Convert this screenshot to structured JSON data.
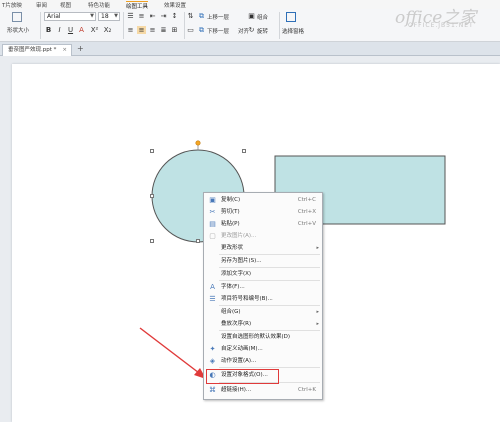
{
  "menu_tabs": [
    "T片放映",
    "审阅",
    "视图",
    "特色功能",
    "绘图工具",
    "效果设置"
  ],
  "ribbon": {
    "shape_size_label": "形状大小",
    "font_name": "Arial",
    "font_size": "18",
    "bring_forward": "上移一层",
    "send_backward": "下移一层",
    "align": "对齐",
    "group": "组合",
    "rotate": "旋转",
    "selection_pane": "选择窗格"
  },
  "document_tab": {
    "name": "垂奈图严效现.ppt *",
    "close": "×",
    "new_tab": "+"
  },
  "watermark": {
    "text": "office之家",
    "sub": "OFFICE.JB51.NET"
  },
  "shapes": {
    "fill": "#bfe2e4",
    "stroke": "#555555"
  },
  "context_menu": {
    "items": [
      {
        "label": "复制(C)",
        "shortcut": "Ctrl+C",
        "icon": "copy-icon",
        "glyph": "▣"
      },
      {
        "label": "剪切(T)",
        "shortcut": "Ctrl+X",
        "icon": "scissors-icon",
        "glyph": "✂"
      },
      {
        "label": "粘贴(P)",
        "shortcut": "Ctrl+V",
        "icon": "paste-icon",
        "glyph": "▤"
      },
      {
        "label": "更改图片(A)...",
        "disabled": true,
        "icon": "image-icon",
        "glyph": "▢"
      },
      {
        "label": "更改形状",
        "submenu": true
      },
      {
        "label": "另存为图片(S)..."
      },
      {
        "label": "添加文字(X)"
      },
      {
        "label": "字体(F)...",
        "icon": "font-icon",
        "glyph": "A"
      },
      {
        "label": "项目符号和编号(B)...",
        "icon": "bullet-list-icon",
        "glyph": "☰"
      },
      {
        "label": "组合(G)",
        "submenu": true
      },
      {
        "label": "叠放次序(R)",
        "submenu": true
      },
      {
        "label": "设置自选图形的默认效果(D)"
      },
      {
        "label": "自定义动画(M)...",
        "icon": "animation-icon",
        "glyph": "✦"
      },
      {
        "label": "动作设置(A)...",
        "icon": "action-icon",
        "glyph": "◈"
      },
      {
        "label": "设置对象格式(O)...",
        "icon": "format-object-icon",
        "glyph": "◐"
      },
      {
        "label": "超链接(H)...",
        "shortcut": "Ctrl+K",
        "icon": "hyperlink-icon",
        "glyph": "⌘"
      }
    ]
  },
  "highlight_color": "#e03a3a"
}
